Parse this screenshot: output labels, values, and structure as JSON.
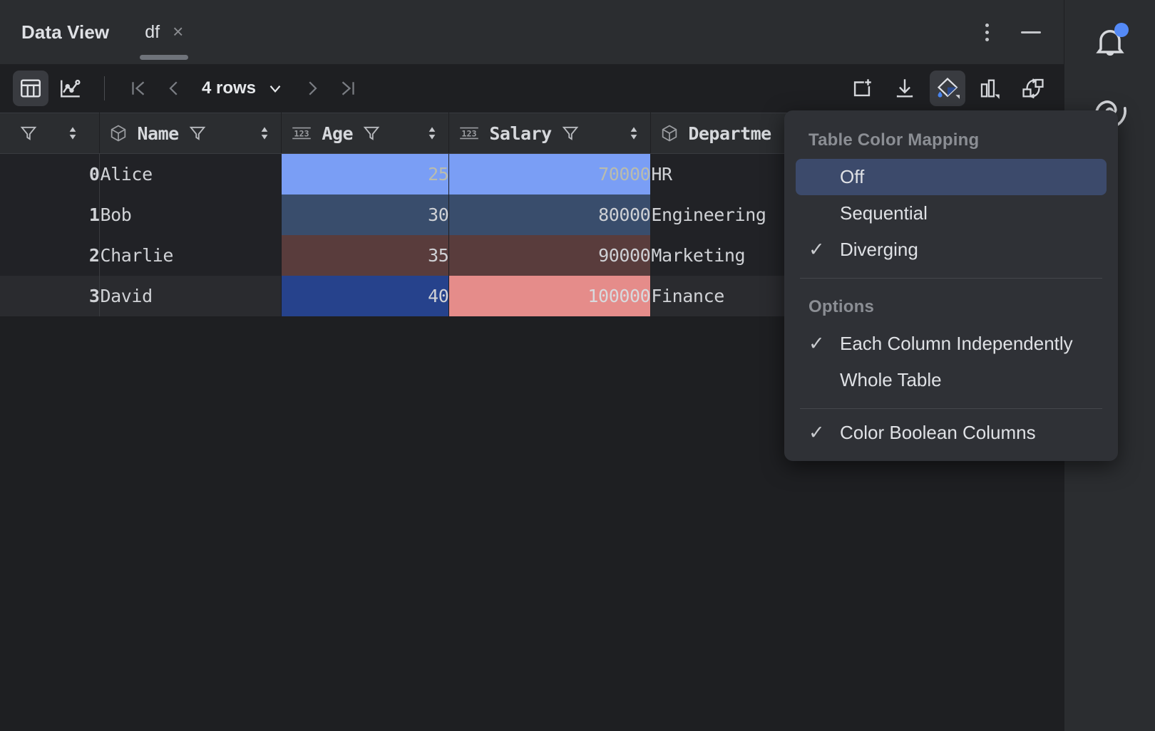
{
  "window": {
    "title": "Data View",
    "minimize_label": "minimize",
    "more_options_label": "more-options"
  },
  "tabs": [
    {
      "label": "df",
      "close_label": "×",
      "active": true
    }
  ],
  "toolbar": {
    "view_table_label": "table-view",
    "view_chart_label": "chart-view",
    "pager": {
      "first_label": "first-page",
      "prev_label": "previous-page",
      "rows_label": "4 rows",
      "next_label": "next-page",
      "last_label": "last-page"
    },
    "actions": {
      "open_in_new_label": "open-in-new-window",
      "export_label": "export-data",
      "color_mapping_label": "color-mapping",
      "chart_settings_label": "chart-settings",
      "transpose_label": "transpose-refresh"
    }
  },
  "table": {
    "index_header": "",
    "columns": [
      {
        "name": "Name",
        "type_icon": "cube-icon",
        "type": "object",
        "has_filter": true,
        "has_sort": true
      },
      {
        "name": "Age",
        "type_icon": "numeric-icon",
        "type": "123",
        "has_filter": true,
        "has_sort": true
      },
      {
        "name": "Salary",
        "type_icon": "numeric-icon",
        "type": "123",
        "has_filter": true,
        "has_sort": true
      },
      {
        "name": "Departme",
        "type_icon": "cube-icon",
        "type": "object",
        "has_filter": false,
        "has_sort": false
      }
    ],
    "rows": [
      {
        "index": "0",
        "Name": "Alice",
        "Age": "25",
        "Salary": "70000",
        "Department": "HR",
        "age_color": "#7a9ef5",
        "salary_color": "#7a9ef5",
        "age_text_color": "#b9bcae",
        "salary_text_color": "#b9bcae",
        "row_bg": "#212226"
      },
      {
        "index": "1",
        "Name": "Bob",
        "Age": "30",
        "Salary": "80000",
        "Department": "Engineering",
        "age_color": "#394d6c",
        "salary_color": "#394d6c",
        "age_text_color": "#cfd1d5",
        "salary_text_color": "#cfd1d5",
        "row_bg": "#212226"
      },
      {
        "index": "2",
        "Name": "Charlie",
        "Age": "35",
        "Salary": "90000",
        "Department": "Marketing",
        "age_color": "#593c3c",
        "salary_color": "#593c3c",
        "age_text_color": "#cfd1d5",
        "salary_text_color": "#cfd1d5",
        "row_bg": "#212226"
      },
      {
        "index": "3",
        "Name": "David",
        "Age": "40",
        "Salary": "100000",
        "Department": "Finance",
        "age_color": "#26428c",
        "salary_color": "#e58c8a",
        "age_text_color": "#cfd1d5",
        "salary_text_color": "#d8dade",
        "row_bg": "#2a2b2f"
      }
    ]
  },
  "menu": {
    "section_title": "Table Color Mapping",
    "mapping_items": [
      {
        "label": "Off",
        "checked": false,
        "highlighted": true
      },
      {
        "label": "Sequential",
        "checked": false,
        "highlighted": false
      },
      {
        "label": "Diverging",
        "checked": true,
        "highlighted": false
      }
    ],
    "options_title": "Options",
    "option_items": [
      {
        "label": "Each Column Independently",
        "checked": true
      },
      {
        "label": "Whole Table",
        "checked": false
      }
    ],
    "footer_items": [
      {
        "label": "Color Boolean Columns",
        "checked": true
      }
    ],
    "check_glyph": "✓",
    "highlight_color": "#3c4a6b"
  },
  "sidebar": {
    "items": [
      {
        "icon": "bell-icon",
        "label": "notifications",
        "has_badge": true
      },
      {
        "icon": "spiral-icon",
        "label": "ai-assistant",
        "has_badge": false
      }
    ]
  },
  "colors": {
    "accent": "#548af7",
    "window_bg": "#1e1f22",
    "panel_bg": "#2b2d30",
    "menu_bg": "#2f3136"
  }
}
